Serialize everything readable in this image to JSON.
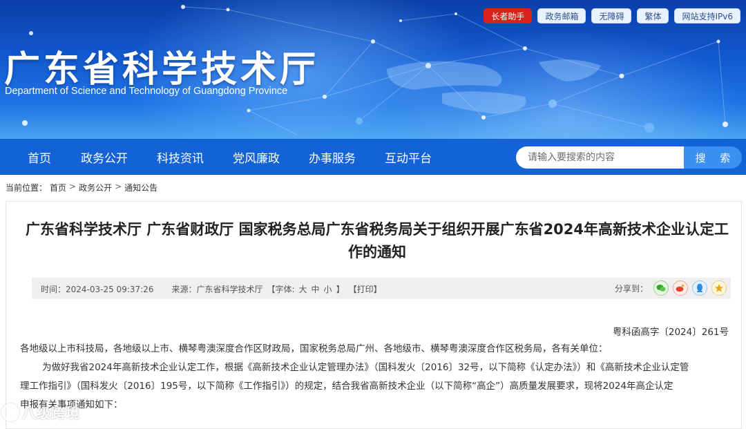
{
  "header": {
    "title": "广东省科学技术厅",
    "subtitle": "Department of Science and Technology of Guangdong Province",
    "top_links": [
      {
        "label": "长者助手",
        "icon": "elder-assistant"
      },
      {
        "label": "政务邮箱"
      },
      {
        "label": "无障碍"
      },
      {
        "label": "繁体"
      },
      {
        "label": "网站支持IPv6"
      }
    ]
  },
  "nav": {
    "items": [
      "首页",
      "政务公开",
      "科技资讯",
      "党风廉政",
      "办事服务",
      "互动平台"
    ],
    "search_placeholder": "请输入要搜索的内容",
    "search_button": "搜 索"
  },
  "breadcrumb": {
    "prefix": "当前位置：",
    "items": [
      "首页",
      "政务公开",
      "通知公告"
    ],
    "separator": ">"
  },
  "article": {
    "title": "广东省科学技术厅 广东省财政厅 国家税务总局广东省税务局关于组织开展广东省2024年高新技术企业认定工作的通知",
    "meta": {
      "time": "时间：2024-03-25 09:37:26",
      "source": "来源：广东省科学技术厅",
      "font_label": "【字体:",
      "font_large": "大",
      "font_medium": "中",
      "font_small": "小",
      "font_close": "】",
      "print": "【打印】",
      "share_label": "分享到："
    },
    "share_icons": [
      "wechat-icon",
      "weibo-icon",
      "qq-icon",
      "qzone-icon"
    ],
    "doc_number": "粤科函高字〔2024〕261号",
    "body": [
      "各地级以上市科技局，各地级以上市、横琴粤澳深度合作区财政局，国家税务总局广州、各地级市、横琴粤澳深度合作区税务局，各有关单位：",
      "为做好我省2024年高新技术企业认定工作，根据《高新技术企业认定管理办法》（国科发火〔2016〕32号，以下简称《认定办法》）和《高新技术企业认定管",
      "理工作指引》（国科发火〔2016〕195号，以下简称《工作指引》）的规定，结合我省高新技术企业（以下简称“高企”）高质量发展要求，现将2024年高企认定",
      "申报有关事项通知如下："
    ]
  },
  "watermark": {
    "text": "八级跨境"
  },
  "colors": {
    "banner_top": "#0a3ea8",
    "nav_bg": "#1363d6",
    "search_button": "#3b8ff0",
    "elder_button": "#d8231a",
    "meta_bar": "#efefef"
  }
}
